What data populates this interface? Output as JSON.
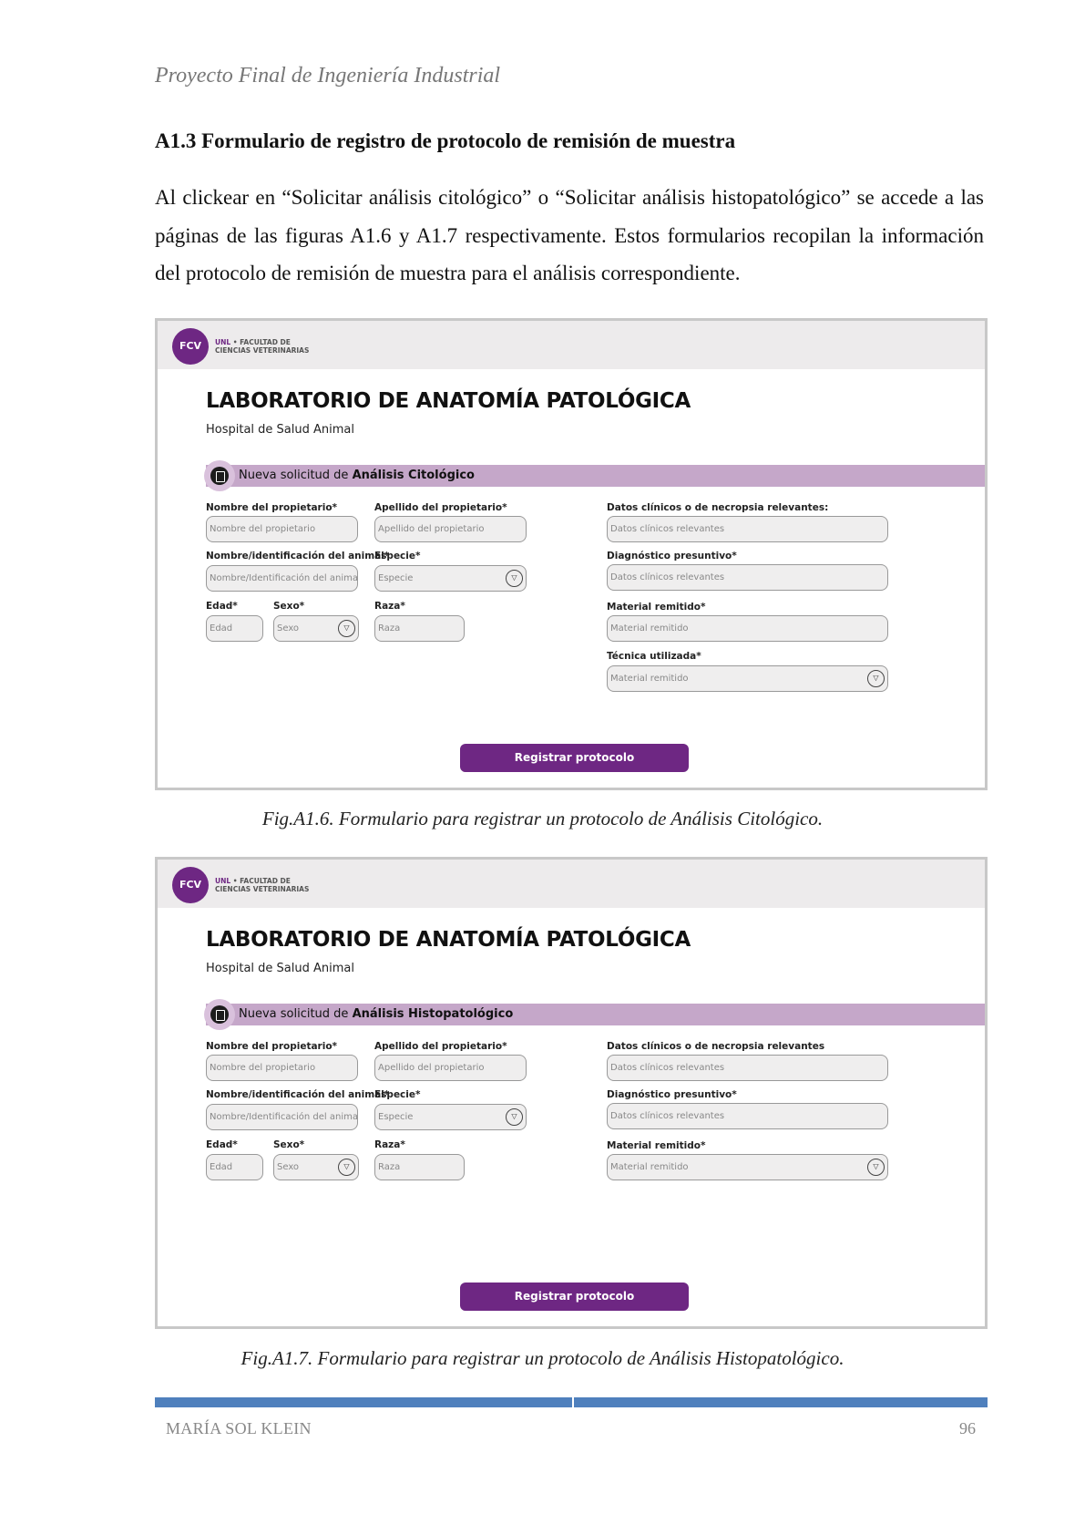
{
  "header": {
    "running_title": "Proyecto Final de Ingeniería Industrial"
  },
  "section": {
    "title": "A1.3 Formulario de registro de protocolo de remisión de muestra",
    "paragraph": "Al clickear en “Solicitar análisis citológico” o “Solicitar análisis histopatológico” se accede a las páginas de las figuras A1.6 y A1.7 respectivamente. Estos formularios recopilan la información del protocolo de remisión de muestra para el análisis correspondiente."
  },
  "figures": [
    {
      "logo": "FCV",
      "inst_unl": "UNL",
      "inst_line1": " • FACULTAD DE",
      "inst_line2": "CIENCIAS VETERINARIAS",
      "lab_title": "LABORATORIO DE ANATOMÍA PATOLÓGICA",
      "lab_subtitle": "Hospital de Salud Animal",
      "banner_prefix": "Nueva solicitud de ",
      "banner_bold": "Análisis Citológico",
      "fields": {
        "owner_name": {
          "label": "Nombre del propietario*",
          "placeholder": "Nombre del propietario"
        },
        "owner_surname": {
          "label": "Apellido del propietario*",
          "placeholder": "Apellido del propietario"
        },
        "clinical": {
          "label": "Datos clínicos o de necropsia relevantes:",
          "placeholder": "Datos clínicos relevantes"
        },
        "animal_id": {
          "label": "Nombre/identificación del animal*",
          "placeholder": "Nombre/Identificación del animal"
        },
        "species": {
          "label": "Especie*",
          "placeholder": "Especie"
        },
        "diagnosis": {
          "label": "Diagnóstico presuntivo*",
          "placeholder": "Datos clínicos relevantes"
        },
        "age": {
          "label": "Edad*",
          "placeholder": "Edad"
        },
        "sex": {
          "label": "Sexo*",
          "placeholder": "Sexo"
        },
        "breed": {
          "label": "Raza*",
          "placeholder": "Raza"
        },
        "material": {
          "label": "Material remitido*",
          "placeholder": "Material remitido"
        },
        "technique": {
          "label": "Técnica utilizada*",
          "placeholder": "Material remitido"
        }
      },
      "button": "Registrar protocolo",
      "caption": "Fig.A1.6. Formulario para registrar un protocolo de Análisis Citológico."
    },
    {
      "logo": "FCV",
      "inst_unl": "UNL",
      "inst_line1": " • FACULTAD DE",
      "inst_line2": "CIENCIAS VETERINARIAS",
      "lab_title": "LABORATORIO DE ANATOMÍA PATOLÓGICA",
      "lab_subtitle": "Hospital de Salud Animal",
      "banner_prefix": "Nueva solicitud de ",
      "banner_bold": "Análisis Histopatológico",
      "fields": {
        "owner_name": {
          "label": "Nombre del propietario*",
          "placeholder": "Nombre del propietario"
        },
        "owner_surname": {
          "label": "Apellido del propietario*",
          "placeholder": "Apellido del propietario"
        },
        "clinical": {
          "label": "Datos clínicos o de necropsia relevantes",
          "placeholder": "Datos clínicos relevantes"
        },
        "animal_id": {
          "label": "Nombre/identificación del animal*",
          "placeholder": "Nombre/Identificación del animal"
        },
        "species": {
          "label": "Especie*",
          "placeholder": "Especie"
        },
        "diagnosis": {
          "label": "Diagnóstico presuntivo*",
          "placeholder": "Datos clínicos relevantes"
        },
        "age": {
          "label": "Edad*",
          "placeholder": "Edad"
        },
        "sex": {
          "label": "Sexo*",
          "placeholder": "Sexo"
        },
        "breed": {
          "label": "Raza*",
          "placeholder": "Raza"
        },
        "material": {
          "label": "Material remitido*",
          "placeholder": "Material remitido"
        }
      },
      "button": "Registrar protocolo",
      "caption": "Fig.A1.7. Formulario para registrar un protocolo de Análisis Histopatológico."
    }
  ],
  "footer": {
    "author": "MARÍA SOL KLEIN",
    "page_number": "96"
  },
  "colors": {
    "brand_purple": "#6e2783",
    "banner_lilac": "#c5a7c9",
    "footer_blue": "#4f80bd"
  }
}
